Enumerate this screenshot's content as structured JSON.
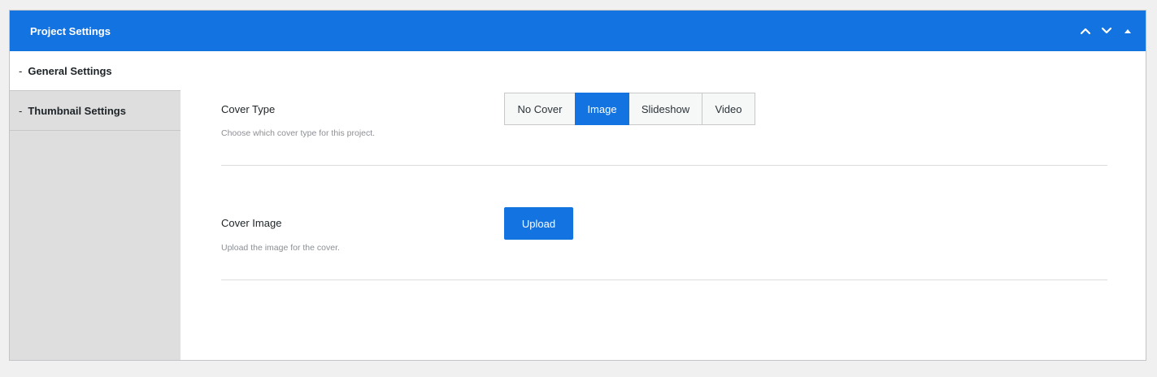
{
  "header": {
    "title": "Project Settings",
    "actions": [
      {
        "icon": "chevron-up-icon"
      },
      {
        "icon": "chevron-down-icon"
      },
      {
        "icon": "triangle-up-icon"
      }
    ]
  },
  "sidebar": {
    "items": [
      {
        "dash": "-",
        "label": "General Settings",
        "active": true
      },
      {
        "dash": "-",
        "label": "Thumbnail Settings",
        "active": false
      }
    ]
  },
  "fields": {
    "cover_type": {
      "label": "Cover Type",
      "description": "Choose which cover type for this project.",
      "options": [
        "No Cover",
        "Image",
        "Slideshow",
        "Video"
      ],
      "selected": "Image"
    },
    "cover_image": {
      "label": "Cover Image",
      "description": "Upload the image for the cover.",
      "button_label": "Upload"
    }
  },
  "colors": {
    "accent": "#1373e0",
    "page_background": "#f0f0f1",
    "sidebar_background": "#dedede"
  }
}
